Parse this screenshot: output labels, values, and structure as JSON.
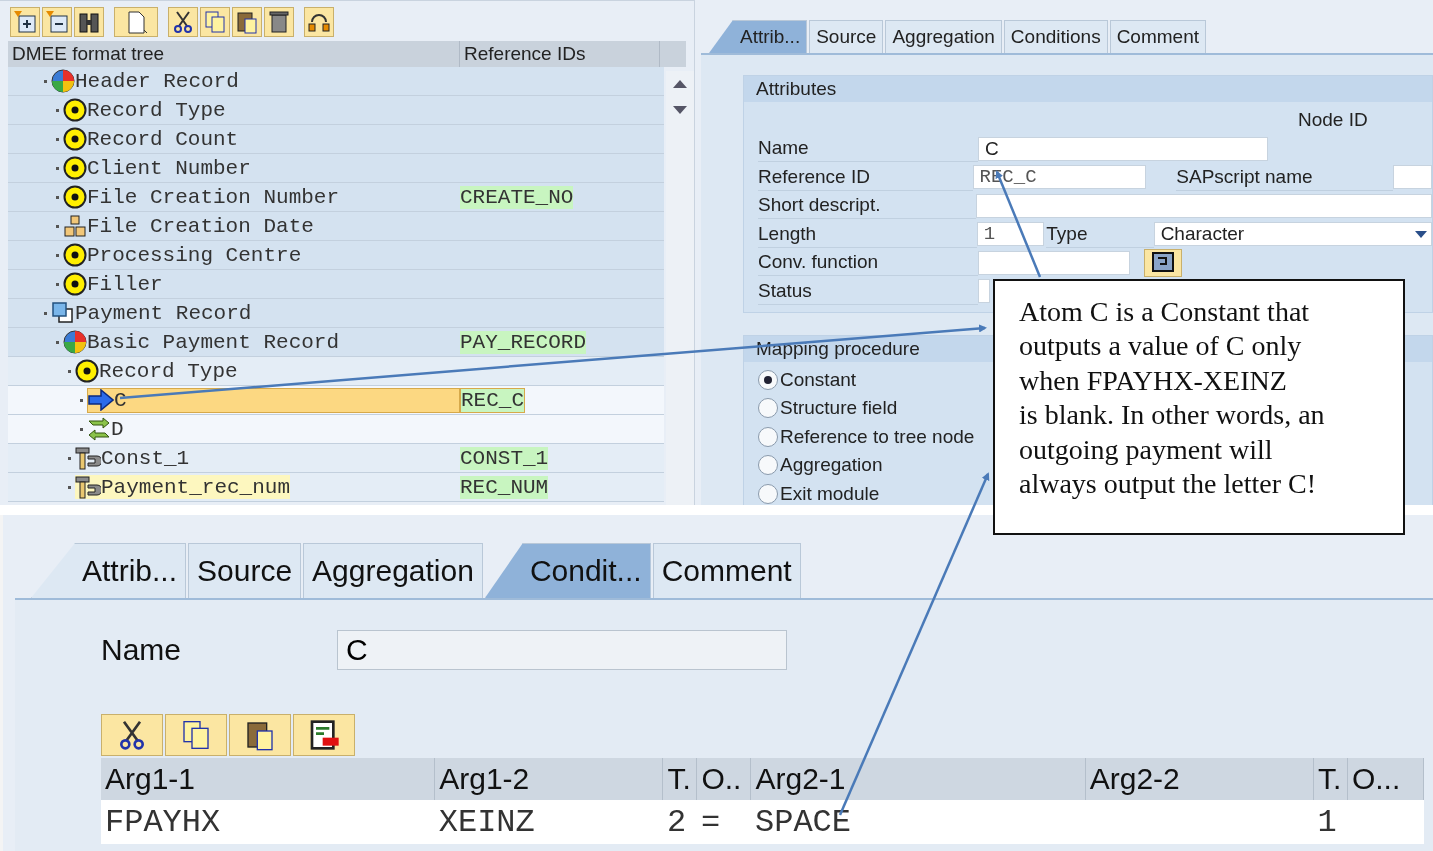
{
  "tree": {
    "columns": [
      "DMEE format tree",
      "Reference IDs"
    ],
    "nodes": [
      {
        "label": "Header Record",
        "kind": "record",
        "selected": false,
        "highlighted": false,
        "children": [
          {
            "label": "Record Type",
            "kind": "field",
            "selected": false,
            "highlighted": false
          },
          {
            "label": "Record Count",
            "kind": "field",
            "selected": false,
            "highlighted": false
          },
          {
            "label": "Client Number",
            "kind": "field",
            "selected": false,
            "highlighted": false
          },
          {
            "label": "File Creation Number",
            "kind": "field",
            "ref": "CREATE_NO",
            "selected": false,
            "highlighted": false
          },
          {
            "label": "File Creation Date",
            "kind": "structure",
            "selected": false,
            "highlighted": false
          },
          {
            "label": "Processing Centre",
            "kind": "field",
            "selected": false,
            "highlighted": false
          },
          {
            "label": "Filler",
            "kind": "field",
            "selected": false,
            "highlighted": false
          }
        ]
      },
      {
        "label": "Payment Record",
        "kind": "group",
        "selected": false,
        "highlighted": false,
        "children": [
          {
            "label": "Basic Payment Record",
            "kind": "record",
            "ref": "PAY_RECORD",
            "selected": false,
            "highlighted": false,
            "children": [
              {
                "label": "Record Type",
                "kind": "field",
                "selected": false,
                "highlighted": false,
                "children": [
                  {
                    "label": "C",
                    "kind": "constant",
                    "ref": "REC_C",
                    "selected": true,
                    "highlighted": false
                  },
                  {
                    "label": "D",
                    "kind": "condition",
                    "selected": false,
                    "highlighted": false
                  }
                ]
              },
              {
                "label": "Const_1",
                "kind": "technical",
                "ref": "CONST_1",
                "selected": false,
                "highlighted": false
              },
              {
                "label": "Payment_rec_num",
                "kind": "technical",
                "ref": "REC_NUM",
                "selected": false,
                "highlighted": true
              }
            ]
          }
        ]
      }
    ]
  },
  "attributes_panel": {
    "tabs": [
      {
        "label": "Attrib...",
        "selected": true
      },
      {
        "label": "Source",
        "selected": false
      },
      {
        "label": "Aggregation",
        "selected": false
      },
      {
        "label": "Conditions",
        "selected": false
      },
      {
        "label": "Comment",
        "selected": false
      }
    ],
    "group_title": "Attributes",
    "node_id_label": "Node ID",
    "name": {
      "label": "Name",
      "value": "C"
    },
    "reference_id": {
      "label": "Reference ID",
      "value": "REC_C"
    },
    "sapscript_name": {
      "label": "SAPscript name"
    },
    "short_description": {
      "label": "Short descript."
    },
    "length": {
      "label": "Length",
      "value": "1"
    },
    "type": {
      "label": "Type",
      "value": "Character"
    },
    "conversion_function": {
      "label": "Conv. function"
    },
    "status": {
      "label": "Status"
    },
    "mapping_procedure": {
      "title": "Mapping procedure",
      "options": [
        {
          "label": "Constant",
          "selected": true
        },
        {
          "label": "Structure field",
          "selected": false
        },
        {
          "label": "Reference to tree node",
          "selected": false
        },
        {
          "label": "Aggregation",
          "selected": false
        },
        {
          "label": "Exit module",
          "selected": false
        }
      ]
    }
  },
  "callout": {
    "lines": [
      "Atom C is a Constant that",
      "outputs a value of C only",
      "when FPAYHX-XEINZ",
      "is blank. In other words, an",
      "outgoing payment will",
      "always output the letter C!"
    ]
  },
  "conditions_panel": {
    "tabs": [
      {
        "label": "Attrib...",
        "selected": false
      },
      {
        "label": "Source",
        "selected": false
      },
      {
        "label": "Aggregation",
        "selected": false
      },
      {
        "label": "Condit...",
        "selected": true
      },
      {
        "label": "Comment",
        "selected": false
      }
    ],
    "name": {
      "label": "Name",
      "value": "C"
    },
    "table": {
      "columns": [
        "Arg1-1",
        "Arg1-2",
        "T.",
        "O..",
        "Arg2-1",
        "Arg2-2",
        "T.",
        "O..."
      ],
      "rows": [
        {
          "cells": [
            "FPAYHX",
            "XEINZ",
            "2",
            "=",
            "SPACE",
            null,
            "1",
            null
          ]
        }
      ]
    }
  }
}
